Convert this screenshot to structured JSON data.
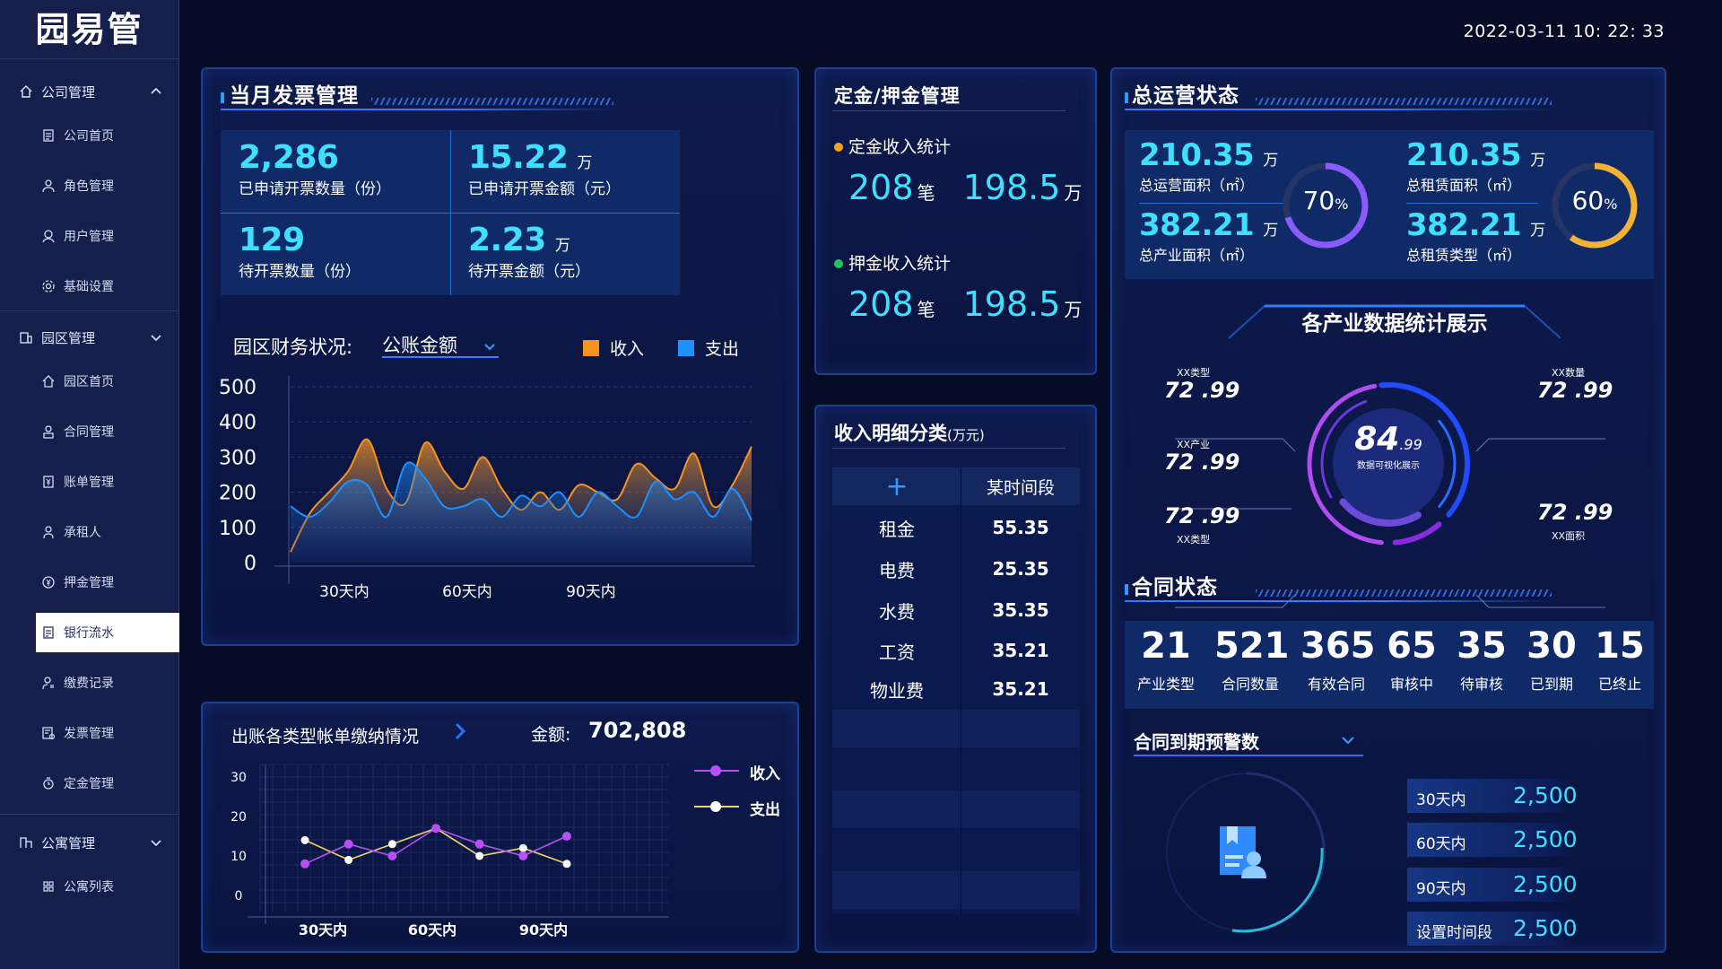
{
  "app": {
    "logo": "园易管",
    "datetime": "2022-03-11 10: 22: 33"
  },
  "sidebar": {
    "groups": [
      {
        "label": "公司管理",
        "icon": "home-icon",
        "items": [
          {
            "label": "公司首页",
            "icon": "document-icon"
          },
          {
            "label": "角色管理",
            "icon": "user-icon"
          },
          {
            "label": "用户管理",
            "icon": "users-icon"
          },
          {
            "label": "基础设置",
            "icon": "gear-icon"
          }
        ]
      },
      {
        "label": "园区管理",
        "icon": "building-icon",
        "items": [
          {
            "label": "园区首页",
            "icon": "home-icon"
          },
          {
            "label": "合同管理",
            "icon": "contract-icon"
          },
          {
            "label": "账单管理",
            "icon": "bill-icon"
          },
          {
            "label": "承租人",
            "icon": "person-icon"
          },
          {
            "label": "押金管理",
            "icon": "coin-icon"
          },
          {
            "label": "银行流水",
            "icon": "bank-icon",
            "active": true
          },
          {
            "label": "缴费记录",
            "icon": "payment-icon"
          },
          {
            "label": "发票管理",
            "icon": "invoice-icon"
          },
          {
            "label": "定金管理",
            "icon": "deposit-icon"
          }
        ]
      },
      {
        "label": "公寓管理",
        "icon": "apartment-icon",
        "items": [
          {
            "label": "公寓列表",
            "icon": "grid-icon"
          }
        ]
      }
    ]
  },
  "invoice": {
    "title": "当月发票管理",
    "stats": [
      {
        "value": "2,286",
        "unit": "",
        "label": "已申请开票数量（份）"
      },
      {
        "value": "15.22",
        "unit": "万",
        "label": "已申请开票金额（元）"
      },
      {
        "value": "129",
        "unit": "",
        "label": "待开票数量（份）"
      },
      {
        "value": "2.23",
        "unit": "万",
        "label": "待开票金额（元）"
      }
    ],
    "finance_label": "园区财务状况:",
    "finance_select": "公账金额",
    "legend": [
      {
        "name": "收入",
        "color": "#f7931e"
      },
      {
        "name": "支出",
        "color": "#1e90ff"
      }
    ]
  },
  "deposit": {
    "title": "定金/押金管理",
    "sections": [
      {
        "label": "定金收入统计",
        "dot": "#f7a21e",
        "count": "208",
        "count_unit": "笔",
        "amount": "198.5",
        "amount_unit": "万"
      },
      {
        "label": "押金收入统计",
        "dot": "#22c55e",
        "count": "208",
        "count_unit": "笔",
        "amount": "198.5",
        "amount_unit": "万"
      }
    ]
  },
  "income_detail": {
    "title": "收入明细分类",
    "title_unit": "(万元)",
    "add_symbol": "+",
    "col_header": "某时间段",
    "rows": [
      {
        "name": "租金",
        "value": "55.35"
      },
      {
        "name": "电费",
        "value": "25.35"
      },
      {
        "name": "水费",
        "value": "35.35"
      },
      {
        "name": "工资",
        "value": "35.21"
      },
      {
        "name": "物业费",
        "value": "35.21"
      }
    ]
  },
  "billing": {
    "title": "出账各类型帐单缴纳情况",
    "amount_label": "金额:",
    "amount": "702,808",
    "legend": [
      {
        "name": "收入",
        "color": "#b650f5"
      },
      {
        "name": "支出",
        "color": "#f1d46a"
      }
    ]
  },
  "operations": {
    "title": "总运营状态",
    "left": {
      "top_value": "210.35",
      "top_unit": "万",
      "top_label": "总运营面积（㎡）",
      "bottom_value": "382.21",
      "bottom_unit": "万",
      "bottom_label": "总产业面积（㎡）",
      "gauge_value": "70",
      "gauge_unit": "%",
      "gauge_pct": 0.7,
      "gauge_color": "#8a5cff"
    },
    "right": {
      "top_value": "210.35",
      "top_unit": "万",
      "top_label": "总租赁面积（㎡）",
      "bottom_value": "382.21",
      "bottom_unit": "万",
      "bottom_label": "总租赁类型（㎡）",
      "gauge_value": "60",
      "gauge_unit": "%",
      "gauge_pct": 0.6,
      "gauge_color": "#f2b233"
    },
    "industry_title": "各产业数据统计展示",
    "center_value": "84",
    "center_suffix": ".99",
    "center_label": "数据可视化展示",
    "industry_items": [
      {
        "label": "XX类型",
        "value": "72 .99"
      },
      {
        "label": "XX数量",
        "value": "72 .99"
      },
      {
        "label": "XX产业",
        "value": "72 .99"
      },
      {
        "label": "XX类型",
        "value": "72 .99"
      },
      {
        "label": "XX面积",
        "value": "72 .99"
      }
    ]
  },
  "contract": {
    "title": "合同状态",
    "stats": [
      {
        "value": "21",
        "label": "产业类型",
        "color": "#3fe0ff"
      },
      {
        "value": "521",
        "label": "合同数量",
        "color": "#3fe0ff"
      },
      {
        "value": "365",
        "label": "有效合同",
        "color": "#3fe0ff"
      },
      {
        "value": "65",
        "label": "审核中",
        "color": "#22c55e"
      },
      {
        "value": "35",
        "label": "待审核",
        "color": "#f59e2b"
      },
      {
        "value": "30",
        "label": "已到期",
        "color": "#d946ef"
      },
      {
        "value": "15",
        "label": "已终止",
        "color": "#ef2b2b"
      }
    ],
    "alert_title": "合同到期预警数",
    "alerts": [
      {
        "label": "30天内",
        "value": "2,500"
      },
      {
        "label": "60天内",
        "value": "2,500"
      },
      {
        "label": "90天内",
        "value": "2,500"
      },
      {
        "label": "设置时间段",
        "value": "2,500"
      }
    ]
  },
  "chart_data": [
    {
      "type": "area",
      "title": "园区财务状况",
      "ylim": [
        0,
        500
      ],
      "yticks": [
        0,
        100,
        200,
        300,
        400,
        500
      ],
      "xtick_labels": [
        "30天内",
        "60天内",
        "90天内"
      ],
      "x": [
        0,
        1,
        2,
        3,
        4,
        5,
        6,
        7,
        8,
        9,
        10,
        11,
        12,
        13,
        14,
        15,
        16,
        17,
        18,
        19,
        20,
        21,
        22,
        23,
        24
      ],
      "series": [
        {
          "name": "收入",
          "color": "#f7931e",
          "values": [
            30,
            140,
            200,
            260,
            350,
            210,
            170,
            340,
            260,
            210,
            300,
            210,
            150,
            200,
            150,
            220,
            200,
            180,
            280,
            240,
            210,
            310,
            160,
            220,
            330
          ]
        },
        {
          "name": "支出",
          "color": "#1e90ff",
          "values": [
            160,
            130,
            170,
            230,
            220,
            130,
            280,
            240,
            160,
            160,
            180,
            130,
            190,
            160,
            200,
            130,
            200,
            160,
            130,
            230,
            180,
            200,
            130,
            210,
            120
          ]
        }
      ],
      "grid": true
    },
    {
      "type": "line",
      "title": "出账各类型帐单缴纳情况",
      "ylim": [
        0,
        30
      ],
      "yticks": [
        0,
        10,
        20,
        30
      ],
      "xtick_labels": [
        "30天内",
        "60天内",
        "90天内"
      ],
      "x": [
        0,
        1,
        2,
        3,
        4,
        5,
        6
      ],
      "series": [
        {
          "name": "收入",
          "color": "#b650f5",
          "values": [
            8,
            13,
            10,
            17,
            13,
            10,
            15
          ]
        },
        {
          "name": "支出",
          "color": "#f1d46a",
          "values": [
            14,
            9,
            13,
            17,
            10,
            12,
            8
          ]
        }
      ],
      "grid": true
    }
  ]
}
